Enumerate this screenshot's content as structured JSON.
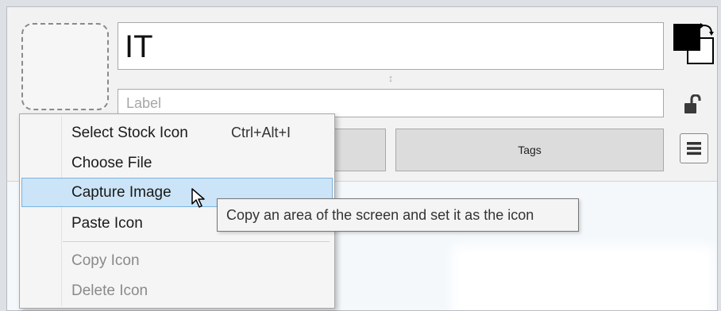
{
  "editor": {
    "title_value": "IT",
    "label_placeholder": "Label",
    "left_button_label": "",
    "tags_button_label": "Tags"
  },
  "icons": {
    "resize_grip": "↕",
    "color_swatch": "foreground-background-swap-icon",
    "lock": "unlocked-padlock-icon",
    "menu": "hamburger-menu-icon",
    "cursor": "mouse-pointer-icon"
  },
  "context_menu": {
    "items": [
      {
        "label": "Select Stock Icon",
        "shortcut": "Ctrl+Alt+I",
        "enabled": true,
        "highlighted": false
      },
      {
        "label": "Choose File",
        "shortcut": "",
        "enabled": true,
        "highlighted": false
      },
      {
        "label": "Capture Image",
        "shortcut": "",
        "enabled": true,
        "highlighted": true
      },
      {
        "label": "Paste Icon",
        "shortcut": "",
        "enabled": true,
        "highlighted": false
      },
      {
        "label": "Copy Icon",
        "shortcut": "",
        "enabled": false,
        "highlighted": false
      },
      {
        "label": "Delete Icon",
        "shortcut": "",
        "enabled": false,
        "highlighted": false
      }
    ]
  },
  "tooltip": {
    "text": "Copy an area of the screen and set it as the icon"
  },
  "colors": {
    "highlight_fill": "#cce4f7",
    "highlight_border": "#7bb3de",
    "disabled_text": "#8a8a8a"
  }
}
